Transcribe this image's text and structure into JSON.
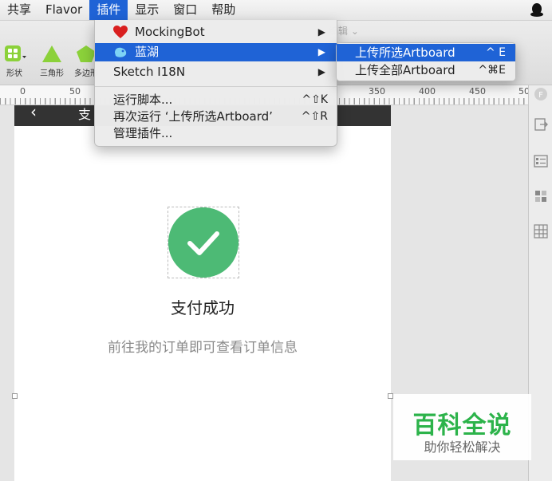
{
  "menubar": {
    "items": [
      {
        "label": "共享",
        "active": false
      },
      {
        "label": "Flavor",
        "active": false
      },
      {
        "label": "插件",
        "active": true
      },
      {
        "label": "显示",
        "active": false
      },
      {
        "label": "窗口",
        "active": false
      },
      {
        "label": "帮助",
        "active": false
      }
    ]
  },
  "toolbar": {
    "tools": [
      {
        "label": "形状",
        "icon": "shape-grid-icon"
      },
      {
        "label": "三角形",
        "icon": "triangle-icon"
      },
      {
        "label": "多边形",
        "icon": "pentagon-icon"
      }
    ],
    "edit_hint": "编辑 ⌄"
  },
  "ruler": {
    "ticks": [
      "0",
      "50",
      "350",
      "400",
      "450",
      "50"
    ]
  },
  "plugins_menu": {
    "items": [
      {
        "label": "MockingBot",
        "icon": "heart-icon",
        "submenu": true,
        "shortcut": ""
      },
      {
        "label": "蓝湖",
        "icon": "lanhu-logo-icon",
        "submenu": true,
        "shortcut": "",
        "highlighted": true
      },
      {
        "label": "Sketch I18N",
        "icon": "",
        "submenu": true,
        "shortcut": ""
      },
      {
        "label": "运行脚本...",
        "icon": "",
        "submenu": false,
        "shortcut": "^⇧K"
      },
      {
        "label": "再次运行 ‘上传所选Artboard’",
        "icon": "",
        "submenu": false,
        "shortcut": "^⇧R"
      },
      {
        "label": "管理插件...",
        "icon": "",
        "submenu": false,
        "shortcut": ""
      }
    ]
  },
  "lanhu_submenu": {
    "items": [
      {
        "label": "上传所选Artboard",
        "shortcut": "^ E",
        "highlighted": true
      },
      {
        "label": "上传全部Artboard",
        "shortcut": "^⌘E",
        "highlighted": false
      }
    ]
  },
  "artboard": {
    "header_back": "‹",
    "header_title": "支",
    "success_title": "支付成功",
    "success_subtitle": "前往我的订单即可查看订单信息"
  },
  "watermark": {
    "title": "百科全说",
    "subtitle": "助你轻松解决"
  },
  "colors": {
    "menu_highlight": "#1f63d6",
    "success_green": "#4dba75",
    "watermark_green": "#2cb34a"
  }
}
